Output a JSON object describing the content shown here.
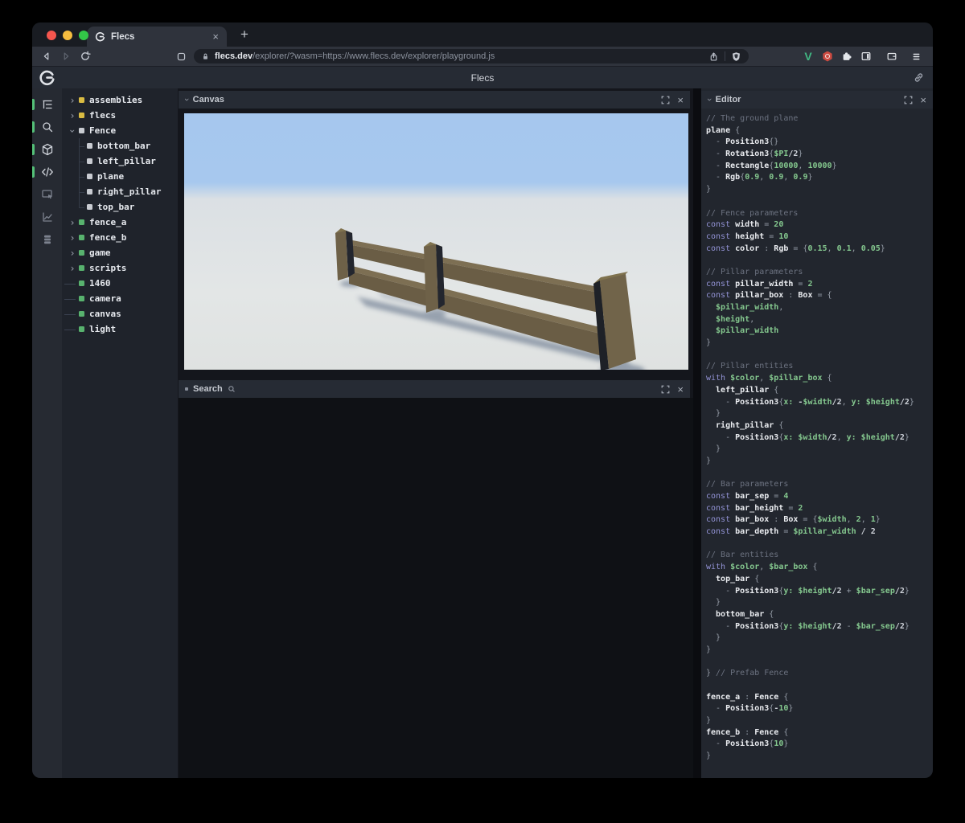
{
  "browser": {
    "tab": {
      "title": "Flecs",
      "close_label": "×",
      "new_tab_label": "+"
    },
    "url": {
      "host": "flecs.dev",
      "path": "/explorer/?wasm=https://www.flecs.dev/explorer/playground.js"
    },
    "toolbar_icons": [
      "back",
      "forward",
      "reload",
      "bookmark"
    ],
    "urlbar_icons": [
      "lock",
      "share",
      "brave-shield"
    ],
    "extension_icons": [
      "vue-devtools",
      "adblock",
      "extensions-puzzle",
      "sidebar-toggle",
      "wallet",
      "menu"
    ],
    "vue_letter": "V"
  },
  "header": {
    "title": "Flecs"
  },
  "sidebar": {
    "icons": [
      {
        "name": "entity-tree",
        "active": true
      },
      {
        "name": "search",
        "active": true
      },
      {
        "name": "scene",
        "active": true
      },
      {
        "name": "script-editor",
        "active": true
      },
      {
        "name": "inspector",
        "active": false
      },
      {
        "name": "stats",
        "active": false
      },
      {
        "name": "commands",
        "active": false
      }
    ]
  },
  "tree": {
    "items": [
      {
        "label": "assemblies",
        "dot": "yellow",
        "exp": "closed"
      },
      {
        "label": "flecs",
        "dot": "yellow",
        "exp": "closed"
      },
      {
        "label": "Fence",
        "dot": "white",
        "exp": "open"
      },
      {
        "label": "bottom_bar",
        "dot": "white",
        "exp": "child"
      },
      {
        "label": "left_pillar",
        "dot": "white",
        "exp": "child"
      },
      {
        "label": "plane",
        "dot": "white",
        "exp": "child"
      },
      {
        "label": "right_pillar",
        "dot": "white",
        "exp": "child"
      },
      {
        "label": "top_bar",
        "dot": "white",
        "exp": "child-last"
      },
      {
        "label": "fence_a",
        "dot": "green",
        "exp": "closed"
      },
      {
        "label": "fence_b",
        "dot": "green",
        "exp": "closed"
      },
      {
        "label": "game",
        "dot": "green",
        "exp": "closed"
      },
      {
        "label": "scripts",
        "dot": "green",
        "exp": "closed"
      },
      {
        "label": "1460",
        "dot": "green",
        "exp": "leaf"
      },
      {
        "label": "camera",
        "dot": "green",
        "exp": "leaf"
      },
      {
        "label": "canvas",
        "dot": "green",
        "exp": "leaf"
      },
      {
        "label": "light",
        "dot": "green",
        "exp": "leaf"
      }
    ]
  },
  "panels": {
    "canvas": {
      "title": "Canvas"
    },
    "search": {
      "title": "Search"
    },
    "editor": {
      "title": "Editor",
      "code": [
        [
          [
            "c",
            "// The ground plane"
          ]
        ],
        [
          [
            "i",
            "plane "
          ],
          [
            "p",
            "{"
          ]
        ],
        [
          [
            "p",
            "  - "
          ],
          [
            "i",
            "Position3"
          ],
          [
            "p",
            "{}"
          ]
        ],
        [
          [
            "p",
            "  - "
          ],
          [
            "i",
            "Rotation3"
          ],
          [
            "p",
            "{"
          ],
          [
            "v",
            "$PI"
          ],
          [
            "w",
            "/2"
          ],
          [
            "p",
            "}"
          ]
        ],
        [
          [
            "p",
            "  - "
          ],
          [
            "i",
            "Rectangle"
          ],
          [
            "p",
            "{"
          ],
          [
            "n",
            "10000"
          ],
          [
            "p",
            ", "
          ],
          [
            "n",
            "10000"
          ],
          [
            "p",
            "}"
          ]
        ],
        [
          [
            "p",
            "  - "
          ],
          [
            "i",
            "Rgb"
          ],
          [
            "p",
            "{"
          ],
          [
            "n",
            "0.9"
          ],
          [
            "p",
            ", "
          ],
          [
            "n",
            "0.9"
          ],
          [
            "p",
            ", "
          ],
          [
            "n",
            "0.9"
          ],
          [
            "p",
            "}"
          ]
        ],
        [
          [
            "p",
            "}"
          ]
        ],
        [],
        [
          [
            "c",
            "// Fence parameters"
          ]
        ],
        [
          [
            "k",
            "const "
          ],
          [
            "i",
            "width"
          ],
          [
            "p",
            " = "
          ],
          [
            "n",
            "20"
          ]
        ],
        [
          [
            "k",
            "const "
          ],
          [
            "i",
            "height"
          ],
          [
            "p",
            " = "
          ],
          [
            "n",
            "10"
          ]
        ],
        [
          [
            "k",
            "const "
          ],
          [
            "i",
            "color"
          ],
          [
            "p",
            " : "
          ],
          [
            "i",
            "Rgb"
          ],
          [
            "p",
            " = {"
          ],
          [
            "n",
            "0.15"
          ],
          [
            "p",
            ", "
          ],
          [
            "n",
            "0.1"
          ],
          [
            "p",
            ", "
          ],
          [
            "n",
            "0.05"
          ],
          [
            "p",
            "}"
          ]
        ],
        [],
        [
          [
            "c",
            "// Pillar parameters"
          ]
        ],
        [
          [
            "k",
            "const "
          ],
          [
            "i",
            "pillar_width"
          ],
          [
            "p",
            " = "
          ],
          [
            "n",
            "2"
          ]
        ],
        [
          [
            "k",
            "const "
          ],
          [
            "i",
            "pillar_box"
          ],
          [
            "p",
            " : "
          ],
          [
            "i",
            "Box"
          ],
          [
            "p",
            " = {"
          ]
        ],
        [
          [
            "v",
            "  $pillar_width"
          ],
          [
            "p",
            ","
          ]
        ],
        [
          [
            "v",
            "  $height"
          ],
          [
            "p",
            ","
          ]
        ],
        [
          [
            "v",
            "  $pillar_width"
          ]
        ],
        [
          [
            "p",
            "}"
          ]
        ],
        [],
        [
          [
            "c",
            "// Pillar entities"
          ]
        ],
        [
          [
            "k",
            "with "
          ],
          [
            "v",
            "$color"
          ],
          [
            "p",
            ", "
          ],
          [
            "v",
            "$pillar_box"
          ],
          [
            "p",
            " {"
          ]
        ],
        [
          [
            "i",
            "  left_pillar "
          ],
          [
            "p",
            "{"
          ]
        ],
        [
          [
            "p",
            "    - "
          ],
          [
            "i",
            "Position3"
          ],
          [
            "p",
            "{"
          ],
          [
            "v",
            "x:"
          ],
          [
            "w",
            " -"
          ],
          [
            "v",
            "$width"
          ],
          [
            "w",
            "/2"
          ],
          [
            "p",
            ", "
          ],
          [
            "v",
            "y: $height"
          ],
          [
            "w",
            "/2"
          ],
          [
            "p",
            "}"
          ]
        ],
        [
          [
            "p",
            "  }"
          ]
        ],
        [
          [
            "i",
            "  right_pillar "
          ],
          [
            "p",
            "{"
          ]
        ],
        [
          [
            "p",
            "    - "
          ],
          [
            "i",
            "Position3"
          ],
          [
            "p",
            "{"
          ],
          [
            "v",
            "x: $width"
          ],
          [
            "w",
            "/2"
          ],
          [
            "p",
            ", "
          ],
          [
            "v",
            "y: $height"
          ],
          [
            "w",
            "/2"
          ],
          [
            "p",
            "}"
          ]
        ],
        [
          [
            "p",
            "  }"
          ]
        ],
        [
          [
            "p",
            "}"
          ]
        ],
        [],
        [
          [
            "c",
            "// Bar parameters"
          ]
        ],
        [
          [
            "k",
            "const "
          ],
          [
            "i",
            "bar_sep"
          ],
          [
            "p",
            " = "
          ],
          [
            "n",
            "4"
          ]
        ],
        [
          [
            "k",
            "const "
          ],
          [
            "i",
            "bar_height"
          ],
          [
            "p",
            " = "
          ],
          [
            "n",
            "2"
          ]
        ],
        [
          [
            "k",
            "const "
          ],
          [
            "i",
            "bar_box"
          ],
          [
            "p",
            " : "
          ],
          [
            "i",
            "Box"
          ],
          [
            "p",
            " = {"
          ],
          [
            "v",
            "$width"
          ],
          [
            "p",
            ", "
          ],
          [
            "n",
            "2"
          ],
          [
            "p",
            ", "
          ],
          [
            "n",
            "1"
          ],
          [
            "p",
            "}"
          ]
        ],
        [
          [
            "k",
            "const "
          ],
          [
            "i",
            "bar_depth"
          ],
          [
            "p",
            " = "
          ],
          [
            "v",
            "$pillar_width"
          ],
          [
            "w",
            " / 2"
          ]
        ],
        [],
        [
          [
            "c",
            "// Bar entities"
          ]
        ],
        [
          [
            "k",
            "with "
          ],
          [
            "v",
            "$color"
          ],
          [
            "p",
            ", "
          ],
          [
            "v",
            "$bar_box"
          ],
          [
            "p",
            " {"
          ]
        ],
        [
          [
            "i",
            "  top_bar "
          ],
          [
            "p",
            "{"
          ]
        ],
        [
          [
            "p",
            "    - "
          ],
          [
            "i",
            "Position3"
          ],
          [
            "p",
            "{"
          ],
          [
            "v",
            "y: $height"
          ],
          [
            "w",
            "/2"
          ],
          [
            "p",
            " + "
          ],
          [
            "v",
            "$bar_sep"
          ],
          [
            "w",
            "/2"
          ],
          [
            "p",
            "}"
          ]
        ],
        [
          [
            "p",
            "  }"
          ]
        ],
        [
          [
            "i",
            "  bottom_bar "
          ],
          [
            "p",
            "{"
          ]
        ],
        [
          [
            "p",
            "    - "
          ],
          [
            "i",
            "Position3"
          ],
          [
            "p",
            "{"
          ],
          [
            "v",
            "y: $height"
          ],
          [
            "w",
            "/2"
          ],
          [
            "p",
            " - "
          ],
          [
            "v",
            "$bar_sep"
          ],
          [
            "w",
            "/2"
          ],
          [
            "p",
            "}"
          ]
        ],
        [
          [
            "p",
            "  }"
          ]
        ],
        [
          [
            "p",
            "}"
          ]
        ],
        [],
        [
          [
            "p",
            "} "
          ],
          [
            "c",
            "// Prefab Fence"
          ]
        ],
        [],
        [
          [
            "i",
            "fence_a"
          ],
          [
            "p",
            " : "
          ],
          [
            "i",
            "Fence"
          ],
          [
            "p",
            " {"
          ]
        ],
        [
          [
            "p",
            "  - "
          ],
          [
            "i",
            "Position3"
          ],
          [
            "p",
            "{"
          ],
          [
            "w",
            "-"
          ],
          [
            "n",
            "10"
          ],
          [
            "p",
            "}"
          ]
        ],
        [
          [
            "p",
            "}"
          ]
        ],
        [
          [
            "i",
            "fence_b"
          ],
          [
            "p",
            " : "
          ],
          [
            "i",
            "Fence"
          ],
          [
            "p",
            " {"
          ]
        ],
        [
          [
            "p",
            "  - "
          ],
          [
            "i",
            "Position3"
          ],
          [
            "p",
            "{"
          ],
          [
            "n",
            "10"
          ],
          [
            "p",
            "}"
          ]
        ],
        [
          [
            "p",
            "}"
          ]
        ]
      ]
    }
  },
  "colors": {
    "accent_green": "#54c078",
    "tree_yellow": "#d9bb42",
    "tree_green": "#58b26e",
    "tree_white": "#c9ccd2",
    "sky": "#a6c7ee",
    "ground": "#e2e5e5",
    "wood_lit": "#6e6148",
    "wood_dark": "#23262e"
  }
}
